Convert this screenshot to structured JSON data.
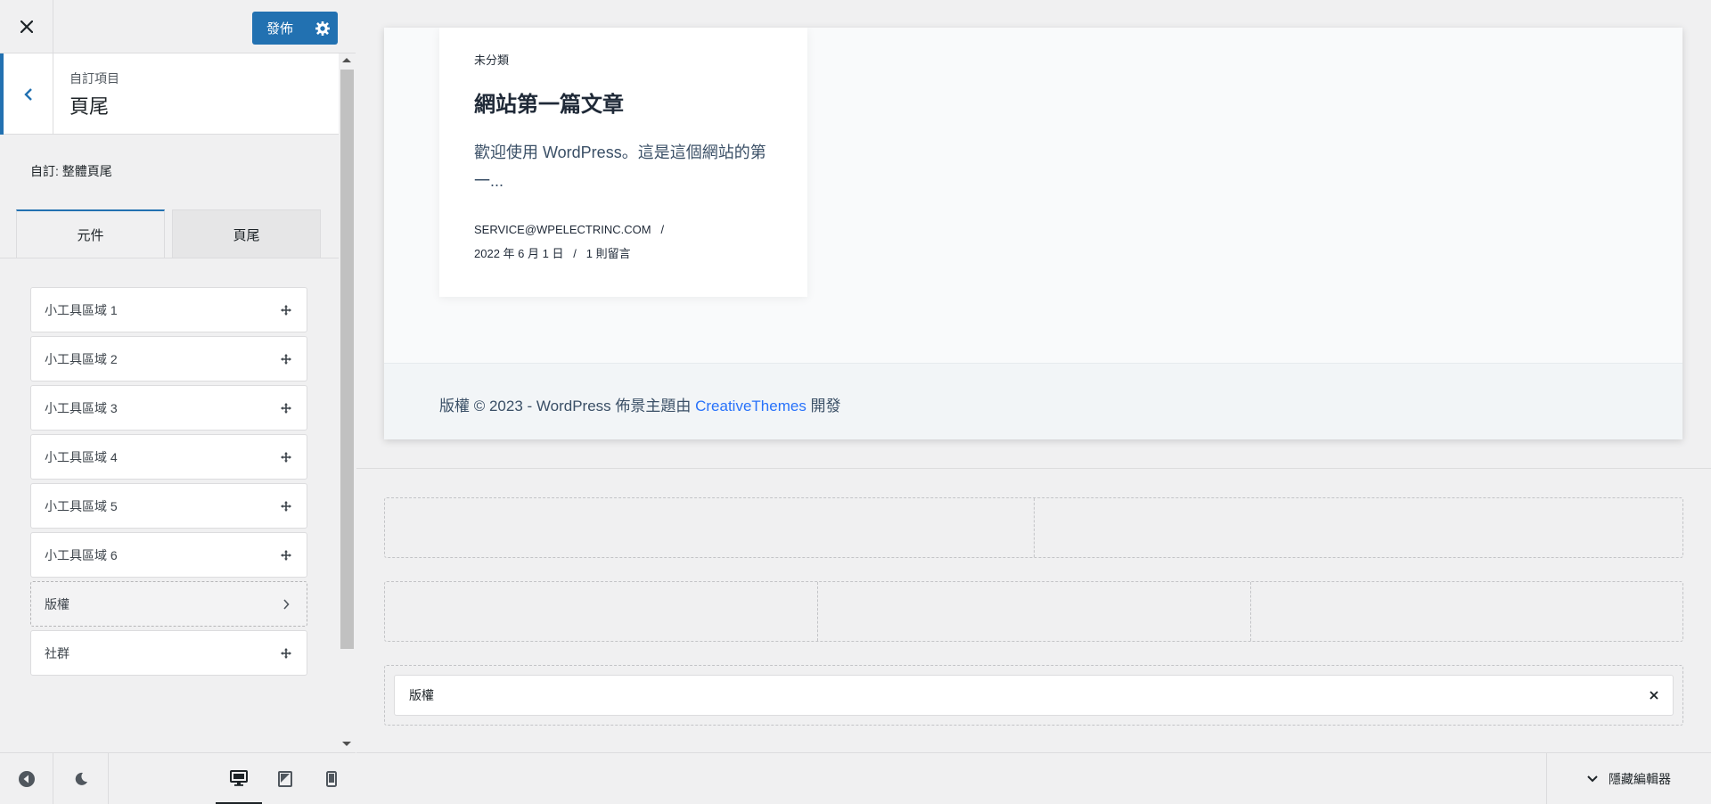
{
  "header": {
    "publish_label": "發佈"
  },
  "section": {
    "subtitle": "自訂項目",
    "title": "頁尾"
  },
  "customize_label": "自訂: 整體頁尾",
  "tabs": [
    {
      "label": "元件",
      "active": true
    },
    {
      "label": "頁尾",
      "active": false
    }
  ],
  "items": [
    {
      "label": "小工具區域 1"
    },
    {
      "label": "小工具區域 2"
    },
    {
      "label": "小工具區域 3"
    },
    {
      "label": "小工具區域 4"
    },
    {
      "label": "小工具區域 5"
    },
    {
      "label": "小工具區域 6"
    },
    {
      "label": "版權"
    },
    {
      "label": "社群"
    }
  ],
  "preview": {
    "card": {
      "category": "未分類",
      "title": "網站第一篇文章",
      "excerpt": "歡迎使用 WordPress。這是這個網站的第一...",
      "meta_author": "SERVICE@WPELECTRINC.COM",
      "meta_sep": "/",
      "meta_date": "2022 年 6 月 1 日",
      "meta_comments": "1 則留言"
    },
    "footer": {
      "copyright_prefix": "版權 © 2023 - WordPress 佈景主題由 ",
      "copyright_link": "CreativeThemes",
      "copyright_suffix": " 開發"
    }
  },
  "builder": {
    "row3_item": "版權"
  },
  "bottom": {
    "hide_editor": "隱藏編輯器"
  },
  "colors": {
    "accent": "#2271b1",
    "link": "#2872fa"
  }
}
